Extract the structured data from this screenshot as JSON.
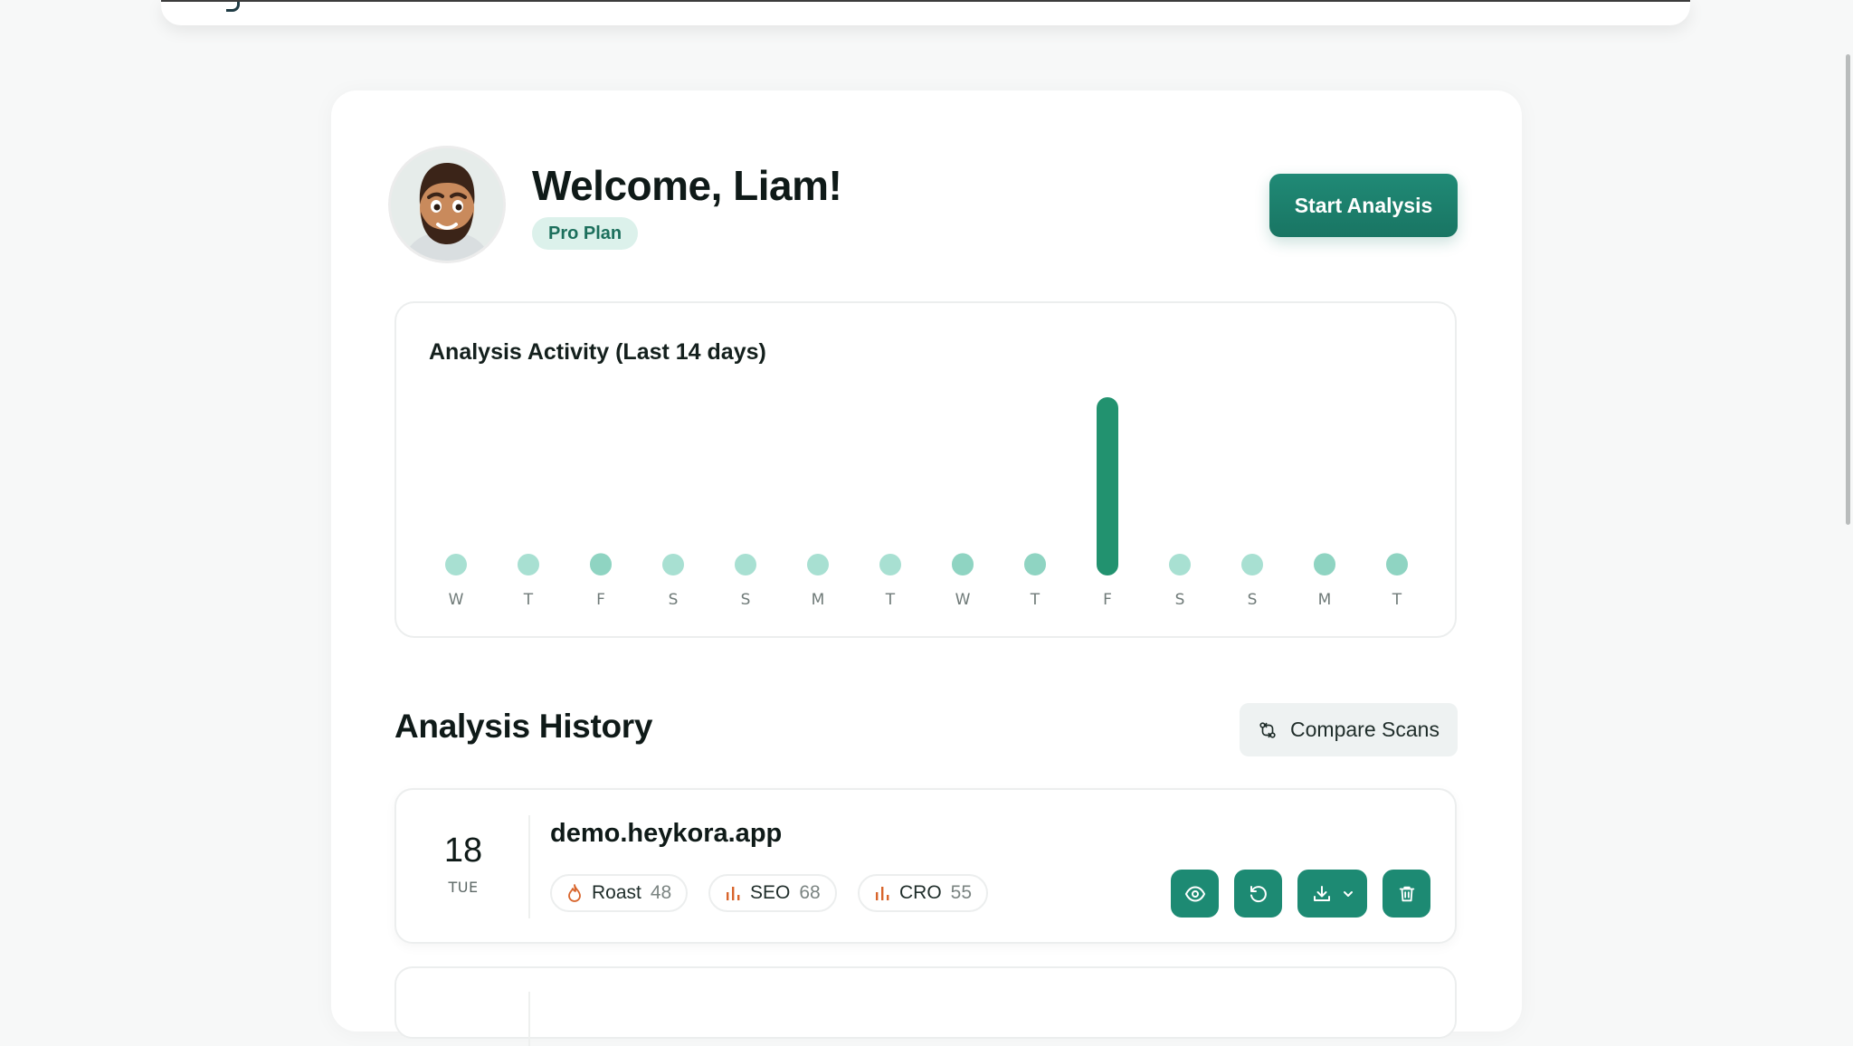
{
  "header": {
    "welcome": "Welcome, Liam!",
    "plan": "Pro Plan",
    "start_button": "Start Analysis"
  },
  "activity": {
    "title": "Analysis Activity (Last 14 days)"
  },
  "chart_data": {
    "type": "bar",
    "title": "Analysis Activity (Last 14 days)",
    "categories": [
      "W",
      "T",
      "F",
      "S",
      "S",
      "M",
      "T",
      "W",
      "T",
      "F",
      "S",
      "S",
      "M",
      "T"
    ],
    "values": [
      0,
      0,
      1,
      0,
      0,
      0,
      0,
      1,
      1,
      8,
      0,
      0,
      1,
      1
    ]
  },
  "history": {
    "title": "Analysis History",
    "compare_button": "Compare Scans",
    "rows": [
      {
        "day_num": "18",
        "day_name": "TUE",
        "domain": "demo.heykora.app",
        "scores": [
          {
            "label": "Roast",
            "value": "48"
          },
          {
            "label": "SEO",
            "value": "68"
          },
          {
            "label": "CRO",
            "value": "55"
          }
        ]
      }
    ]
  },
  "colors": {
    "accent": "#1d8a73",
    "accent_light": "#a8e0d2",
    "roast": "#d8652c",
    "chart_bar": "#22926f"
  },
  "icons": {
    "view": "eye-icon",
    "rerun": "refresh-icon",
    "download": "download-icon",
    "delete": "trash-icon",
    "compare": "compare-icon"
  }
}
